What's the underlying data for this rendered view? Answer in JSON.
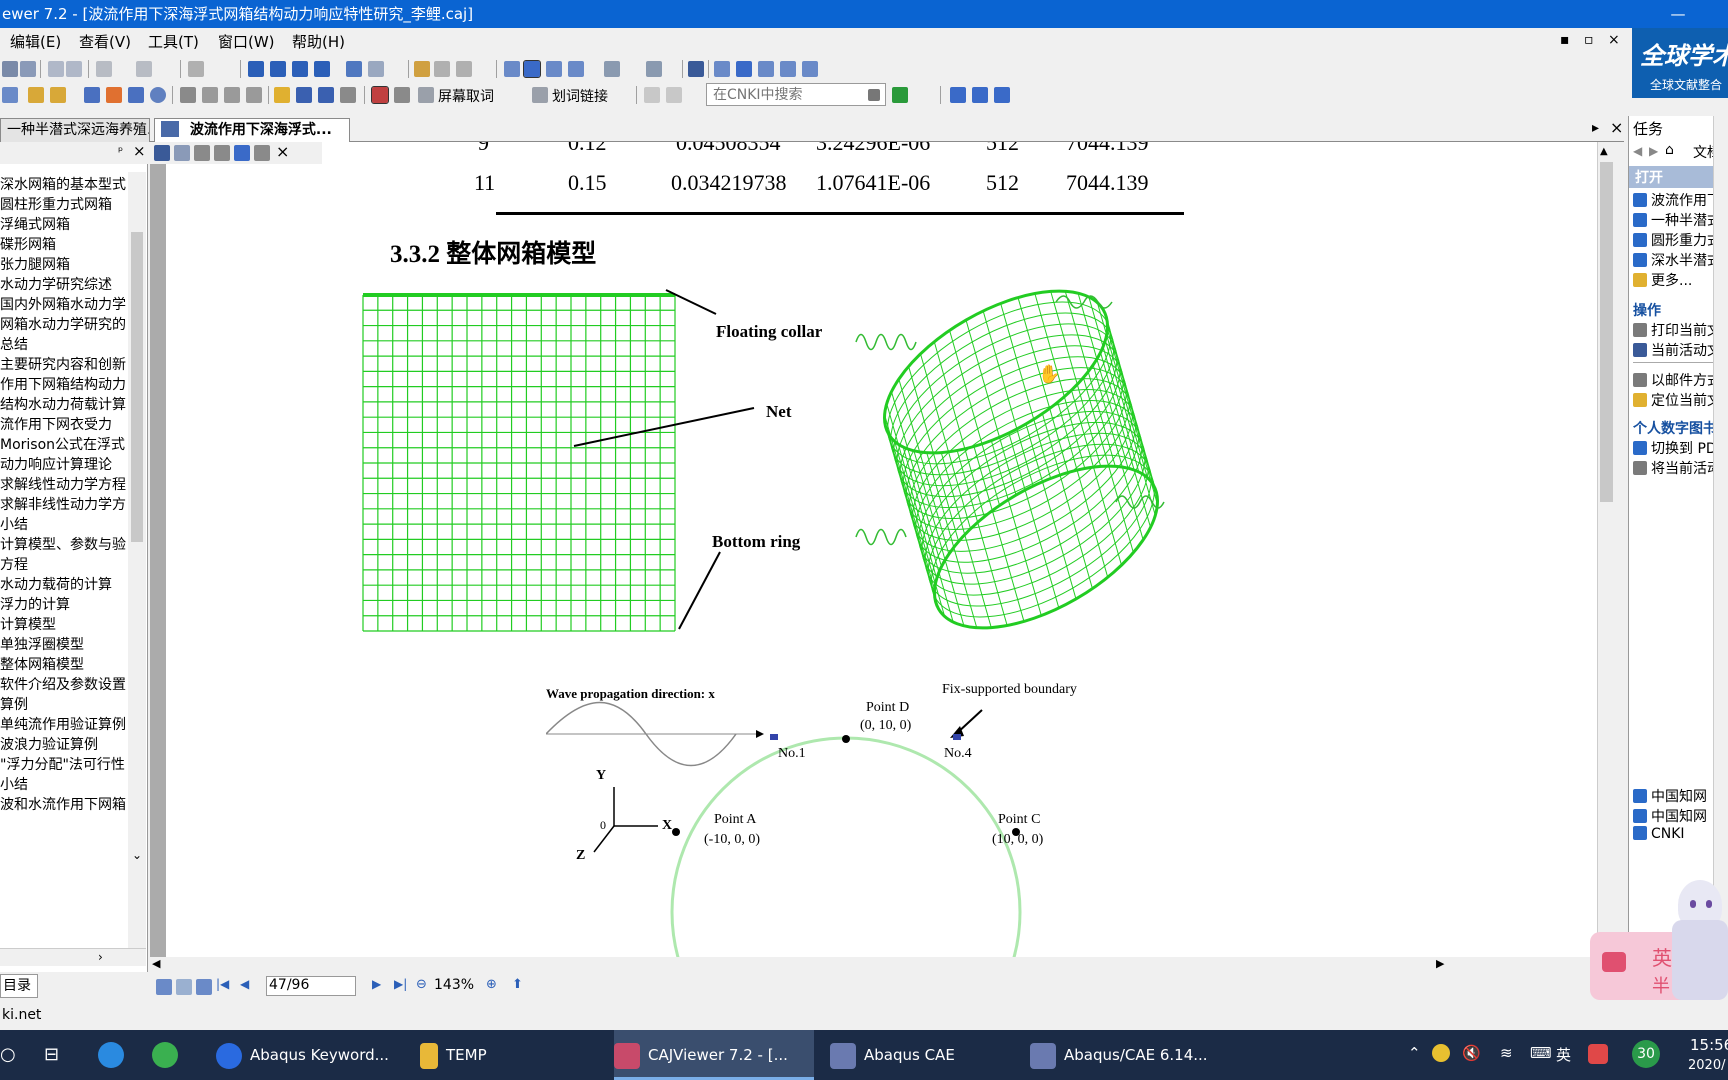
{
  "title_bar": {
    "title": "ewer 7.2 - [波流作用下深海浮式网箱结构动力响应特性研究_李鲤.caj]",
    "minimize_icon": "—"
  },
  "menu": {
    "items": [
      "编辑(E)",
      "查看(V)",
      "工具(T)",
      "窗口(W)",
      "帮助(H)"
    ]
  },
  "window_controls": {
    "minimize": "▪",
    "restore": "▫",
    "close": "×"
  },
  "logo": {
    "text": "全球学术",
    "subtext": "全球文献整合"
  },
  "toolbar2": {
    "screen_unfetch": "屏幕取词",
    "word_link": "划词链接",
    "search_placeholder": "在CNKI中搜索"
  },
  "tabs": [
    {
      "label": "一种半潜式深远海养殖..."
    },
    {
      "label": "波流作用下深海浮式..."
    }
  ],
  "tab_nav": {
    "right": "▸",
    "close": "×"
  },
  "toc": {
    "tab_label": "目录",
    "items": [
      "深水网箱的基本型式",
      "圆柱形重力式网箱",
      "浮绳式网箱",
      "碟形网箱",
      "张力腿网箱",
      "水动力学研究综述",
      "国内外网箱水动力学",
      "网箱水动力学研究的",
      "总结",
      "主要研究内容和创新",
      "作用下网箱结构动力",
      "结构水动力荷载计算",
      "流作用下网衣受力",
      "Morison公式在浮式",
      "动力响应计算理论",
      "求解线性动力学方程",
      "求解非线性动力学方",
      "小结",
      "计算模型、参数与验",
      "方程",
      "水动力载荷的计算",
      "浮力的计算",
      "计算模型",
      "单独浮圈模型",
      "整体网箱模型",
      "软件介绍及参数设置",
      "算例",
      "单纯流作用验证算例",
      "波浪力验证算例",
      "\"浮力分配\"法可行性",
      "小结",
      "波和水流作用下网箱"
    ]
  },
  "document": {
    "table_rows": [
      {
        "c1": "9",
        "c2": "0.12",
        "c3": "0.04508354",
        "c4": "3.24296E-06",
        "c5": "512",
        "c6": "7044.139"
      },
      {
        "c1": "11",
        "c2": "0.15",
        "c3": "0.034219738",
        "c4": "1.07641E-06",
        "c5": "512",
        "c6": "7044.139"
      }
    ],
    "section_title": "3.3.2 整体网箱模型",
    "figure1_labels": {
      "floating_collar": "Floating collar",
      "net": "Net",
      "bottom_ring": "Bottom ring"
    },
    "figure2_labels": {
      "wave_direction": "Wave propagation direction: x",
      "fix_boundary": "Fix-supported boundary",
      "point_d": "Point D",
      "point_d_coord": "(0, 10, 0)",
      "point_a": "Point A",
      "point_a_coord": "(-10, 0, 0)",
      "point_c": "Point  C",
      "point_c_coord": "(10, 0, 0)",
      "no1": "No.1",
      "no4": "No.4",
      "axis_y": "Y",
      "axis_x": "X",
      "axis_z": "Z",
      "axis_o": "0"
    },
    "net_color": "#22cc22"
  },
  "status": {
    "page": "47/96",
    "zoom": "143%"
  },
  "right_panel": {
    "title": "任务",
    "doc_label": "文档",
    "open_head": "打开",
    "open_items": [
      "波流作用下",
      "一种半潜式",
      "圆形重力式",
      "深水半潜式",
      "更多..."
    ],
    "ops_head": "操作",
    "ops_items": [
      "打印当前文",
      "当前活动文"
    ],
    "mail_items": [
      "以邮件方式",
      "定位当前文"
    ],
    "library_head": "个人数字图书",
    "library_items": [
      "切换到 PDF",
      "将当前活动"
    ],
    "bottom_items": [
      "中国知网",
      "中国知网",
      "CNKI"
    ]
  },
  "url_line": "ki.net",
  "taskbar": {
    "apps": [
      "Abaqus Keyword...",
      "TEMP",
      "CAJViewer 7.2 - [...",
      "Abaqus CAE",
      "Abaqus/CAE 6.14..."
    ],
    "tray_ime": "英",
    "tray_badge": "30",
    "clock_time": "15:56",
    "clock_date": "2020/"
  },
  "overlay": {
    "ime_chars": [
      "英",
      "半"
    ]
  }
}
